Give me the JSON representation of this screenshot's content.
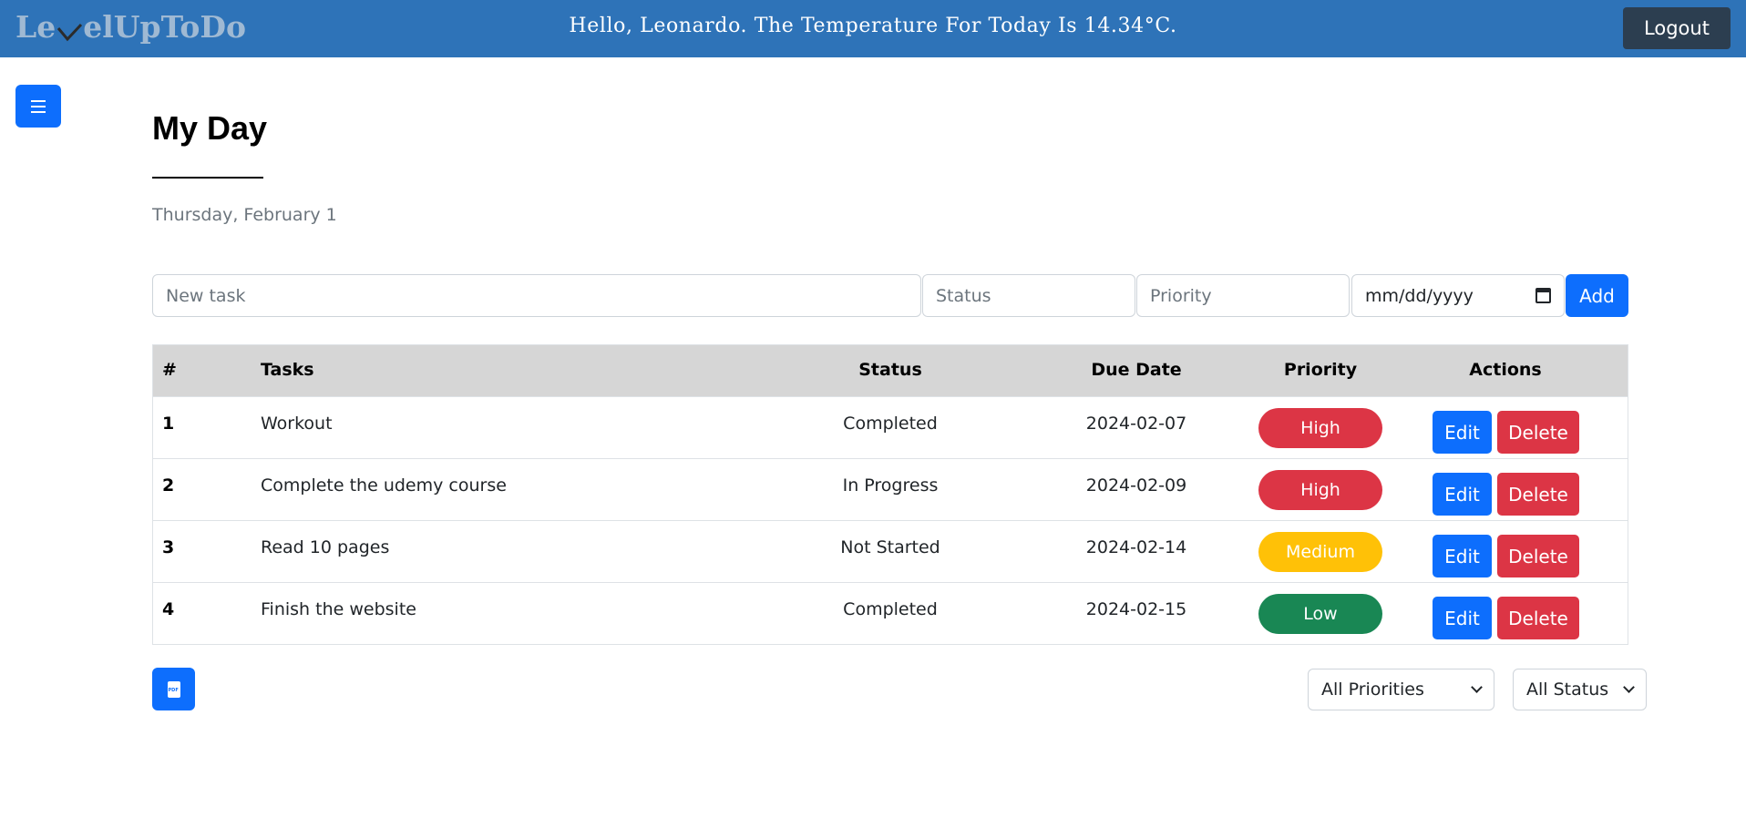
{
  "header": {
    "logo_text_a": "Le",
    "logo_text_b": "elUpToDo",
    "greeting": "Hello, Leonardo. The Temperature For Today Is 14.34°C.",
    "logout_label": "Logout"
  },
  "page": {
    "title": "My Day",
    "date": "Thursday, February 1"
  },
  "form": {
    "task_placeholder": "New task",
    "status_placeholder": "Status",
    "priority_placeholder": "Priority",
    "date_placeholder": "mm/dd/yyyy",
    "add_label": "Add"
  },
  "table": {
    "headers": {
      "num": "#",
      "tasks": "Tasks",
      "status": "Status",
      "due": "Due Date",
      "priority": "Priority",
      "actions": "Actions"
    },
    "rows": [
      {
        "num": "1",
        "task": "Workout",
        "status": "Completed",
        "due": "2024-02-07",
        "priority": "High",
        "priority_color": "#dc3545",
        "edit": "Edit",
        "delete": "Delete"
      },
      {
        "num": "2",
        "task": "Complete the udemy course",
        "status": "In Progress",
        "due": "2024-02-09",
        "priority": "High",
        "priority_color": "#dc3545",
        "edit": "Edit",
        "delete": "Delete"
      },
      {
        "num": "3",
        "task": "Read 10 pages",
        "status": "Not Started",
        "due": "2024-02-14",
        "priority": "Medium",
        "priority_color": "#ffc107",
        "edit": "Edit",
        "delete": "Delete"
      },
      {
        "num": "4",
        "task": "Finish the website",
        "status": "Completed",
        "due": "2024-02-15",
        "priority": "Low",
        "priority_color": "#198754",
        "edit": "Edit",
        "delete": "Delete"
      }
    ]
  },
  "filters": {
    "priority_value": "All Priorities",
    "status_value": "All Status",
    "pdf_icon_text": "PDF"
  },
  "colors": {
    "header_bg": "#2e73b8",
    "primary": "#0d6efd",
    "danger": "#dc3545",
    "warning": "#ffc107",
    "success": "#198754"
  }
}
